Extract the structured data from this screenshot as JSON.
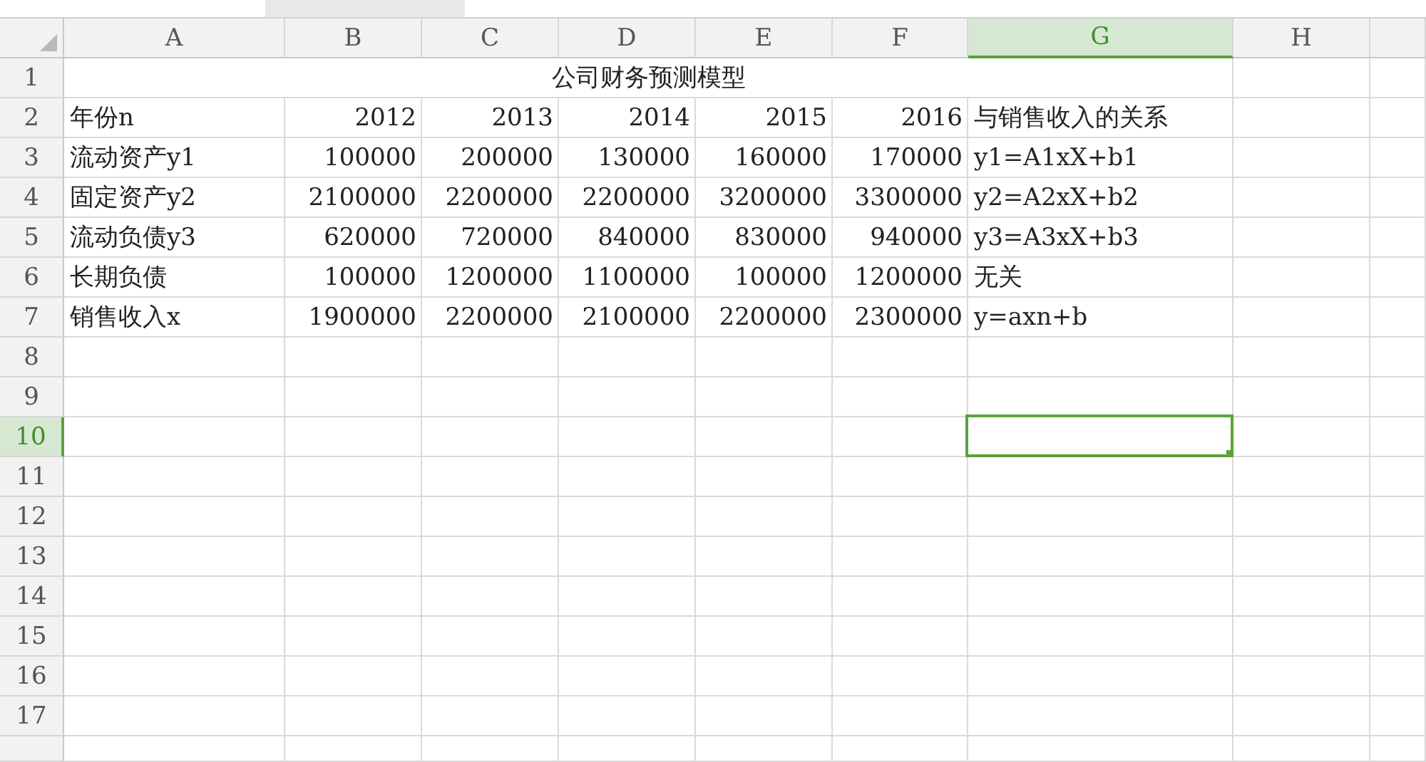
{
  "sheet": {
    "columns": [
      {
        "label": "A",
        "selected": false
      },
      {
        "label": "B",
        "selected": false
      },
      {
        "label": "C",
        "selected": false
      },
      {
        "label": "D",
        "selected": false
      },
      {
        "label": "E",
        "selected": false
      },
      {
        "label": "F",
        "selected": false
      },
      {
        "label": "G",
        "selected": true
      },
      {
        "label": "H",
        "selected": false
      }
    ],
    "rows": [
      {
        "number": "1",
        "selected": false,
        "merged_title": "公司财务预测模型"
      },
      {
        "number": "2",
        "selected": false,
        "cells": [
          {
            "text": "年份n",
            "kind": "text"
          },
          {
            "text": "2012",
            "kind": "number"
          },
          {
            "text": "2013",
            "kind": "number"
          },
          {
            "text": "2014",
            "kind": "number"
          },
          {
            "text": "2015",
            "kind": "number"
          },
          {
            "text": "2016",
            "kind": "number"
          },
          {
            "text": "与销售收入的关系",
            "kind": "text"
          }
        ]
      },
      {
        "number": "3",
        "selected": false,
        "cells": [
          {
            "text": "流动资产y1",
            "kind": "text"
          },
          {
            "text": "100000",
            "kind": "number"
          },
          {
            "text": "200000",
            "kind": "number"
          },
          {
            "text": "130000",
            "kind": "number"
          },
          {
            "text": "160000",
            "kind": "number"
          },
          {
            "text": "170000",
            "kind": "number"
          },
          {
            "text": "y1=A1xX+b1",
            "kind": "text"
          }
        ]
      },
      {
        "number": "4",
        "selected": false,
        "cells": [
          {
            "text": "固定资产y2",
            "kind": "text"
          },
          {
            "text": "2100000",
            "kind": "number"
          },
          {
            "text": "2200000",
            "kind": "number"
          },
          {
            "text": "2200000",
            "kind": "number"
          },
          {
            "text": "3200000",
            "kind": "number"
          },
          {
            "text": "3300000",
            "kind": "number"
          },
          {
            "text": "y2=A2xX+b2",
            "kind": "text"
          }
        ]
      },
      {
        "number": "5",
        "selected": false,
        "cells": [
          {
            "text": "流动负债y3",
            "kind": "text"
          },
          {
            "text": "620000",
            "kind": "number"
          },
          {
            "text": "720000",
            "kind": "number"
          },
          {
            "text": "840000",
            "kind": "number"
          },
          {
            "text": "830000",
            "kind": "number"
          },
          {
            "text": "940000",
            "kind": "number"
          },
          {
            "text": "y3=A3xX+b3",
            "kind": "text"
          }
        ]
      },
      {
        "number": "6",
        "selected": false,
        "cells": [
          {
            "text": "长期负债",
            "kind": "text"
          },
          {
            "text": "100000",
            "kind": "number"
          },
          {
            "text": "1200000",
            "kind": "number"
          },
          {
            "text": "1100000",
            "kind": "number"
          },
          {
            "text": "100000",
            "kind": "number"
          },
          {
            "text": "1200000",
            "kind": "number"
          },
          {
            "text": "无关",
            "kind": "text"
          }
        ]
      },
      {
        "number": "7",
        "selected": false,
        "cells": [
          {
            "text": "销售收入x",
            "kind": "text"
          },
          {
            "text": "1900000",
            "kind": "number"
          },
          {
            "text": "2200000",
            "kind": "number"
          },
          {
            "text": "2100000",
            "kind": "number"
          },
          {
            "text": "2200000",
            "kind": "number"
          },
          {
            "text": "2300000",
            "kind": "number"
          },
          {
            "text": "y=axn+b",
            "kind": "text"
          }
        ]
      },
      {
        "number": "8",
        "selected": false
      },
      {
        "number": "9",
        "selected": false
      },
      {
        "number": "10",
        "selected": true
      },
      {
        "number": "11",
        "selected": false
      },
      {
        "number": "12",
        "selected": false
      },
      {
        "number": "13",
        "selected": false
      },
      {
        "number": "14",
        "selected": false
      },
      {
        "number": "15",
        "selected": false
      },
      {
        "number": "16",
        "selected": false
      },
      {
        "number": "17",
        "selected": false
      }
    ]
  }
}
